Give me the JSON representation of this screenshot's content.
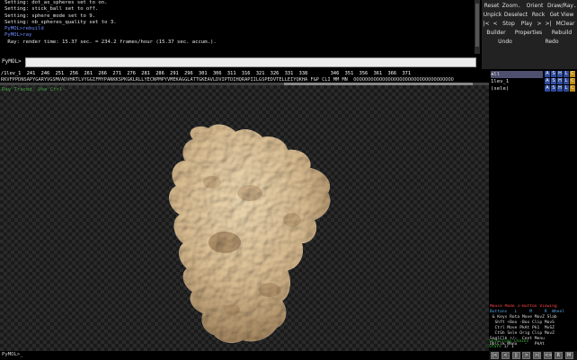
{
  "log": {
    "lines": [
      {
        "text": "Setting: dot_as_spheres set to on.",
        "kind": "output"
      },
      {
        "text": "Setting: stick_ball set to off.",
        "kind": "output"
      },
      {
        "text": "Setting: sphere_mode set to 9.",
        "kind": "output"
      },
      {
        "text": "Setting: nb_spheres_quality set to 3.",
        "kind": "output"
      },
      {
        "text": "PyMOL>rebuild",
        "kind": "cmd"
      },
      {
        "text": "PyMOL>ray",
        "kind": "cmd"
      },
      {
        "text": " Ray: render time: 15.37 sec. = 234.2 frames/hour (15.37 sec. accum.).",
        "kind": "output"
      }
    ]
  },
  "command": {
    "prompt": "PyMOL>",
    "value": ""
  },
  "bottom_prompt": "PyMOL>_",
  "buttons": {
    "row1": [
      "Reset",
      "Zoom",
      "Orient",
      "Draw/Ray"
    ],
    "row2": [
      "Unpick",
      "Deselect",
      "Rock",
      "Get View"
    ],
    "row3": [
      "|<",
      "<",
      "Stop",
      "Play",
      ">",
      ">|",
      "MClear"
    ],
    "row4": [
      "Builder",
      "Properties",
      "Rebuild"
    ],
    "row5": [
      "Undo",
      "Redo"
    ]
  },
  "sequence": {
    "object_label": "/1lev_1",
    "numbers": "  241  246  251  256  261  266  271  276  281  286  291  296  301  306  311  316  321  326  331  338        346  351  356  361  366  371",
    "residues": "RKVFPPDNSAPYGARYVGSMVADVHRTLVYGGIFMYPANKKSPKGKLRLLYECNPMPYVMEKAGGLATTGKEAVLDVIPTDIHQRAPIILGSPEDVTELLEIYQKHA F&P CLI MM MN  OOOOOOOOOOOOOOOOOOOOOOOOOOOOOOOOOOO"
  },
  "viewport": {
    "message": "Ray Traced, Use Ctrl-"
  },
  "objects": [
    {
      "name": "all",
      "highlight": true
    },
    {
      "name": "1lev_1",
      "highlight": false,
      "colored": true
    },
    {
      "name": "(sele)",
      "highlight": false
    }
  ],
  "object_buttons": [
    "A",
    "S",
    "H",
    "L",
    "C"
  ],
  "mouse": {
    "title": "Mouse Mode 3-Button Viewing",
    "header": "Buttons   L     M     R  Wheel",
    "rows": [
      " & Keys Rota Move MovZ Slab",
      "  Shft +Box -Box Clip MovS",
      "  Ctrl Move PkAt Pk1  MvSZ",
      "  CtSh Sele Orig Clip MovZ",
      "SnglClk +/-  Cent Menu",
      "DblClk Menu   -   PkAt"
    ],
    "selecting": "Selecting Chains",
    "state_label": "State",
    "state_value": "1/    1"
  },
  "movie_controls": [
    "|<",
    "<",
    "||",
    ">",
    ">|",
    "<>",
    "R",
    "M"
  ],
  "colors": {
    "surface": "#e3c69c",
    "command_text": "#6f8dff",
    "message_text": "#3fa63f",
    "object_highlight": "#4f4f6f"
  }
}
